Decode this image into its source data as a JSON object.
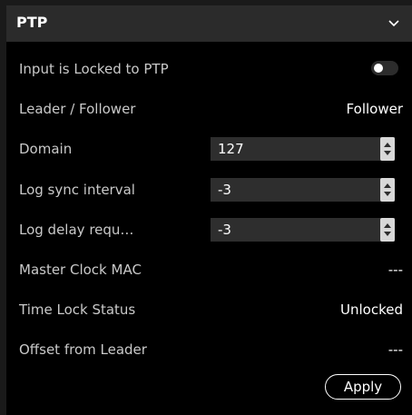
{
  "section": {
    "title": "PTP",
    "collapse_icon": "chevron-down-icon"
  },
  "rows": {
    "input_locked": {
      "label": "Input is Locked to PTP",
      "toggle_on": false
    },
    "leader_follower": {
      "label": "Leader / Follower",
      "value": "Follower"
    },
    "domain": {
      "label": "Domain",
      "value": "127"
    },
    "log_sync_interval": {
      "label": "Log sync interval",
      "value": "-3"
    },
    "log_delay_request": {
      "label": "Log delay requ…",
      "value": "-3"
    },
    "master_clock_mac": {
      "label": "Master Clock MAC",
      "value": "---"
    },
    "time_lock_status": {
      "label": "Time Lock Status",
      "value": "Unlocked"
    },
    "offset_from_leader": {
      "label": "Offset from Leader",
      "value": "---"
    }
  },
  "actions": {
    "apply_label": "Apply"
  },
  "colors": {
    "background": "#000000",
    "header": "#2b2b2b",
    "label": "#c9c9c9",
    "value": "#ffffff",
    "input_bg": "#2e2e2e"
  }
}
